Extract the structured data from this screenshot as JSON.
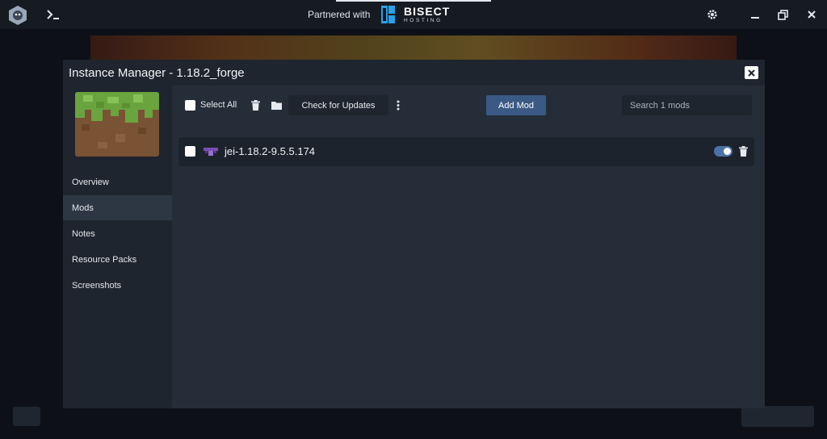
{
  "titlebar": {
    "partner_text": "Partnered with",
    "bisect_name": "BISECT",
    "bisect_sub": "HOSTING",
    "icons": [
      "app-logo-icon",
      "terminal-icon",
      "gear-icon",
      "minimize-icon",
      "maximize-icon",
      "close-icon"
    ]
  },
  "modal": {
    "title": "Instance Manager - 1.18.2_forge",
    "nav": [
      {
        "label": "Overview"
      },
      {
        "label": "Mods"
      },
      {
        "label": "Notes"
      },
      {
        "label": "Resource Packs"
      },
      {
        "label": "Screenshots"
      }
    ],
    "active_nav": "Mods",
    "toolbar": {
      "select_all_label": "Select All",
      "check_updates_label": "Check for Updates",
      "add_mod_label": "Add Mod",
      "search_placeholder": "Search 1 mods"
    },
    "mods": [
      {
        "name": "jei-1.18.2-9.5.5.174",
        "enabled": true
      }
    ]
  },
  "colors": {
    "accent": "#3a5a85",
    "toggle_on": "#4b72a6",
    "modal_bg": "#1e252e",
    "content_bg": "#252d38"
  }
}
